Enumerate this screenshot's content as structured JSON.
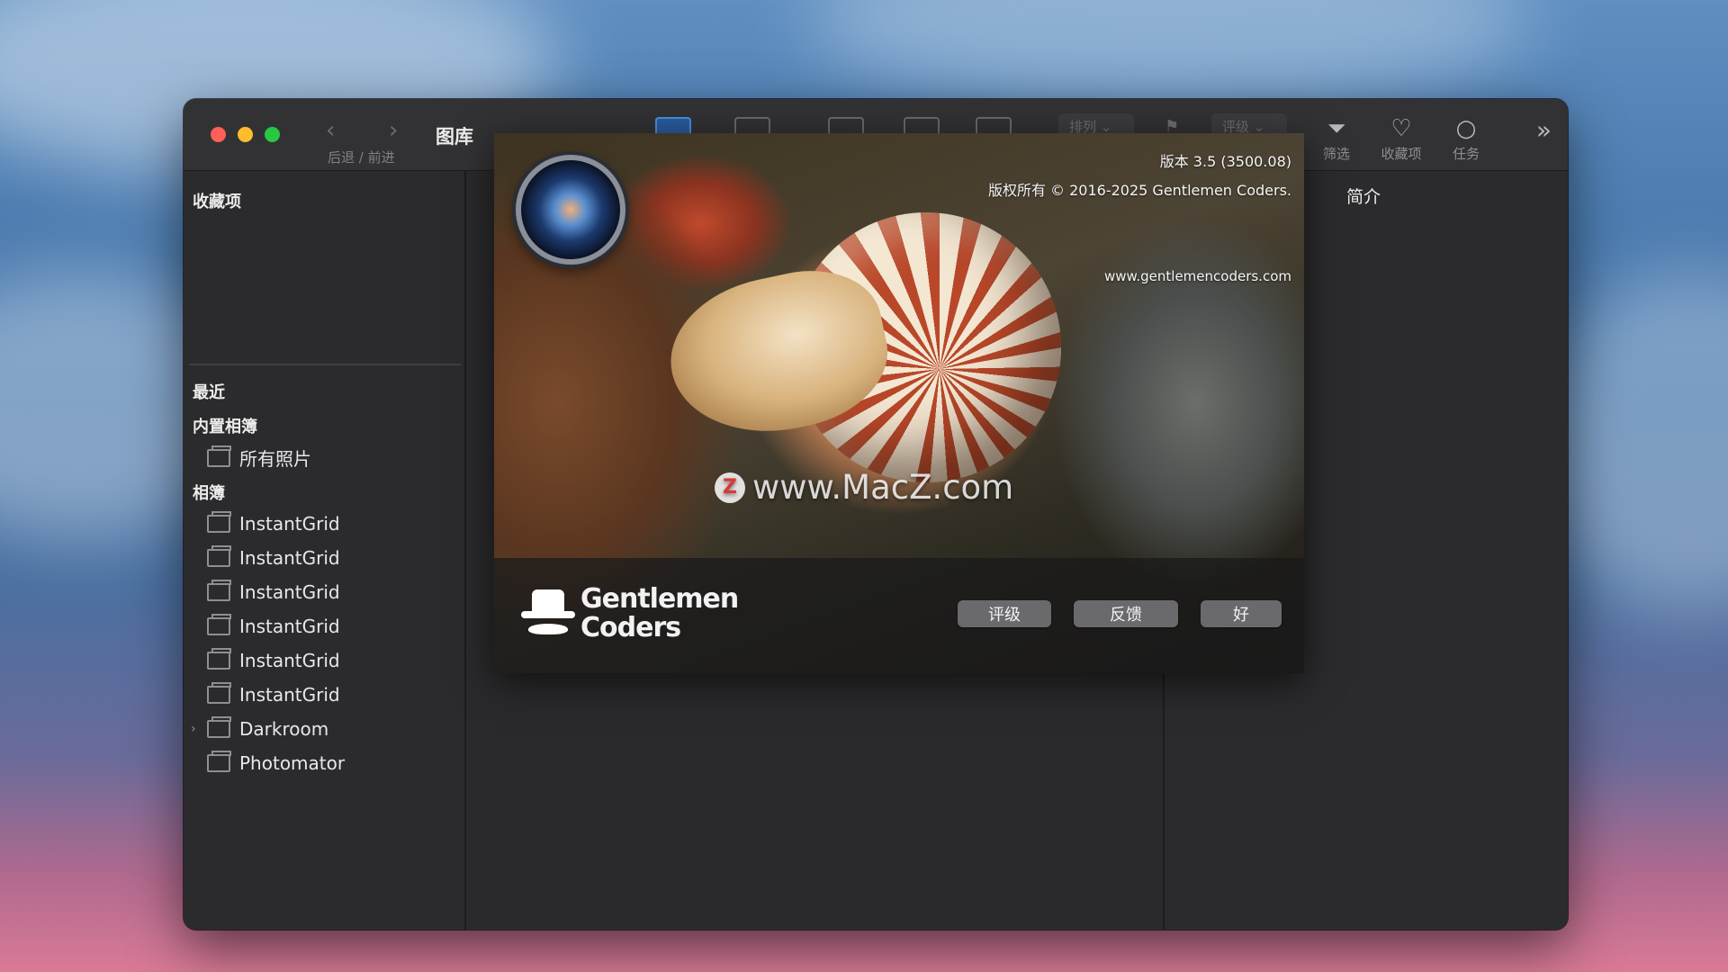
{
  "window": {
    "title": "图库",
    "nav_label": "后退 / 前进"
  },
  "toolbar": {
    "sort_label": "排列",
    "rating_label": "评级",
    "filter_label": "筛选",
    "favorites_label": "收藏项",
    "tasks_label": "任务"
  },
  "sidebar": {
    "favorites_header": "收藏项",
    "recent_header": "最近",
    "builtin_header": "内置相簿",
    "all_photos": "所有照片",
    "albums_header": "相簿",
    "albums": [
      {
        "label": "InstantGrid"
      },
      {
        "label": "InstantGrid"
      },
      {
        "label": "InstantGrid"
      },
      {
        "label": "InstantGrid"
      },
      {
        "label": "InstantGrid"
      },
      {
        "label": "InstantGrid"
      },
      {
        "label": "Darkroom"
      },
      {
        "label": "Photomator"
      }
    ]
  },
  "info_panel": {
    "header": "简介"
  },
  "about": {
    "version": "版本 3.5 (3500.08)",
    "copyright": "版权所有 © 2016-2025 Gentlemen Coders.",
    "website": "www.gentlemencoders.com",
    "watermark": "www.MacZ.com",
    "watermark_badge": "Z",
    "logo_line1": "Gentlemen",
    "logo_line2": "Coders",
    "buttons": {
      "rate": "评级",
      "feedback": "反馈",
      "ok": "好"
    }
  },
  "colors": {
    "close": "#fe5f57",
    "minimize": "#febc2e",
    "zoom": "#28c840",
    "accent": "#2a5b9e"
  }
}
